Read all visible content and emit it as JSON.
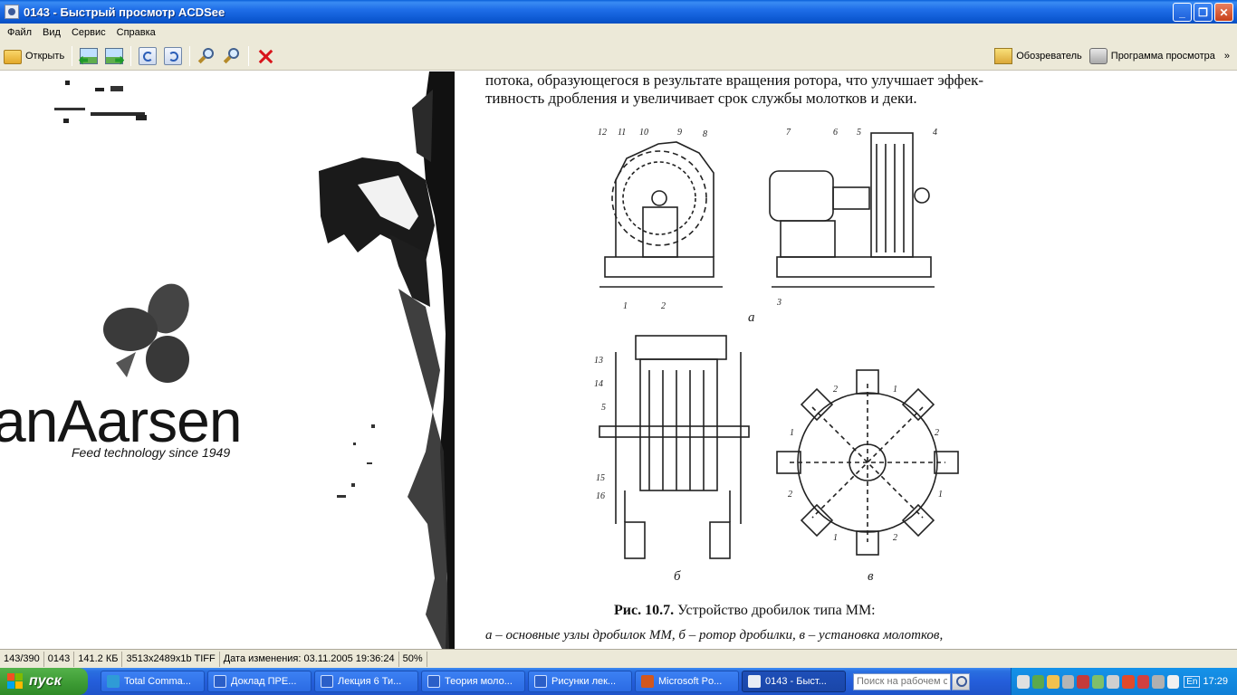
{
  "window": {
    "title": "0143 - Быстрый просмотр ACDSee",
    "controls": {
      "minimize": "_",
      "restore": "❐",
      "close": "✕"
    }
  },
  "menu": [
    "Файл",
    "Вид",
    "Сервис",
    "Справка"
  ],
  "toolbar": {
    "open_label": "Открыть",
    "browser_label": "Обозреватель",
    "viewer_label": "Программа просмотра",
    "more": "»",
    "icons": [
      "open-folder-icon",
      "previous-image-icon",
      "next-image-icon",
      "rotate-left-icon",
      "rotate-right-icon",
      "zoom-in-icon",
      "zoom-out-icon",
      "delete-icon",
      "browser-icon",
      "viewer-icon"
    ]
  },
  "image": {
    "photo": {
      "brand": "anAarsen",
      "tagline": "Feed technology since 1949"
    },
    "page": {
      "line1": "потока, образующегося в результате вращения ротора, что улучшает эффек-",
      "line2": "тивность дробления и увеличивает срок службы молотков и деки.",
      "figure_a_numbers": [
        "12",
        "11",
        "10",
        "9",
        "8",
        "7",
        "6",
        "5",
        "4",
        "1",
        "2",
        "3"
      ],
      "figure_b_numbers": [
        "13",
        "14",
        "5",
        "15",
        "16"
      ],
      "figure_c_numbers": [
        "2",
        "1",
        "1",
        "2",
        "2",
        "1",
        "1",
        "2"
      ],
      "letter_a": "а",
      "letter_b": "б",
      "letter_c": "в",
      "caption_bold": "Рис. 10.7.",
      "caption_rest": "Устройство дробилок типа ММ:",
      "legend": "а – основные узлы дробилок ММ, б – ротор дробилки, в – установка молотков,"
    }
  },
  "status": {
    "position": "143/390",
    "name": "0143",
    "size": "141.2 КБ",
    "dimensions": "3513x2489x1b TIFF",
    "modified": "Дата изменения: 03.11.2005 19:36:24",
    "zoom": "50%"
  },
  "taskbar": {
    "start": "пуск",
    "tasks": [
      {
        "label": "Total Comma...",
        "color": "#2f9bd6"
      },
      {
        "label": "Доклад ПРЕ...",
        "color": "#2b5fc8"
      },
      {
        "label": "Лекция 6 Ти...",
        "color": "#2b5fc8"
      },
      {
        "label": "Теория моло...",
        "color": "#2b5fc8"
      },
      {
        "label": "Рисунки лек...",
        "color": "#2b5fc8"
      },
      {
        "label": "Microsoft Po...",
        "color": "#d2571e"
      },
      {
        "label": "0143 - Быст...",
        "color": "#e8edf5"
      }
    ],
    "search_placeholder": "Поиск на рабочем ст",
    "language": "En",
    "clock": "17:29",
    "tray_colors": [
      "#e0e0e0",
      "#5ba84c",
      "#f2c14e",
      "#b5b5b5",
      "#c43b3b",
      "#7fbf6a",
      "#cfcfcf",
      "#e04a2a",
      "#d24040",
      "#b0b0b0",
      "#f0f0f0",
      "#9aa9c4"
    ]
  }
}
